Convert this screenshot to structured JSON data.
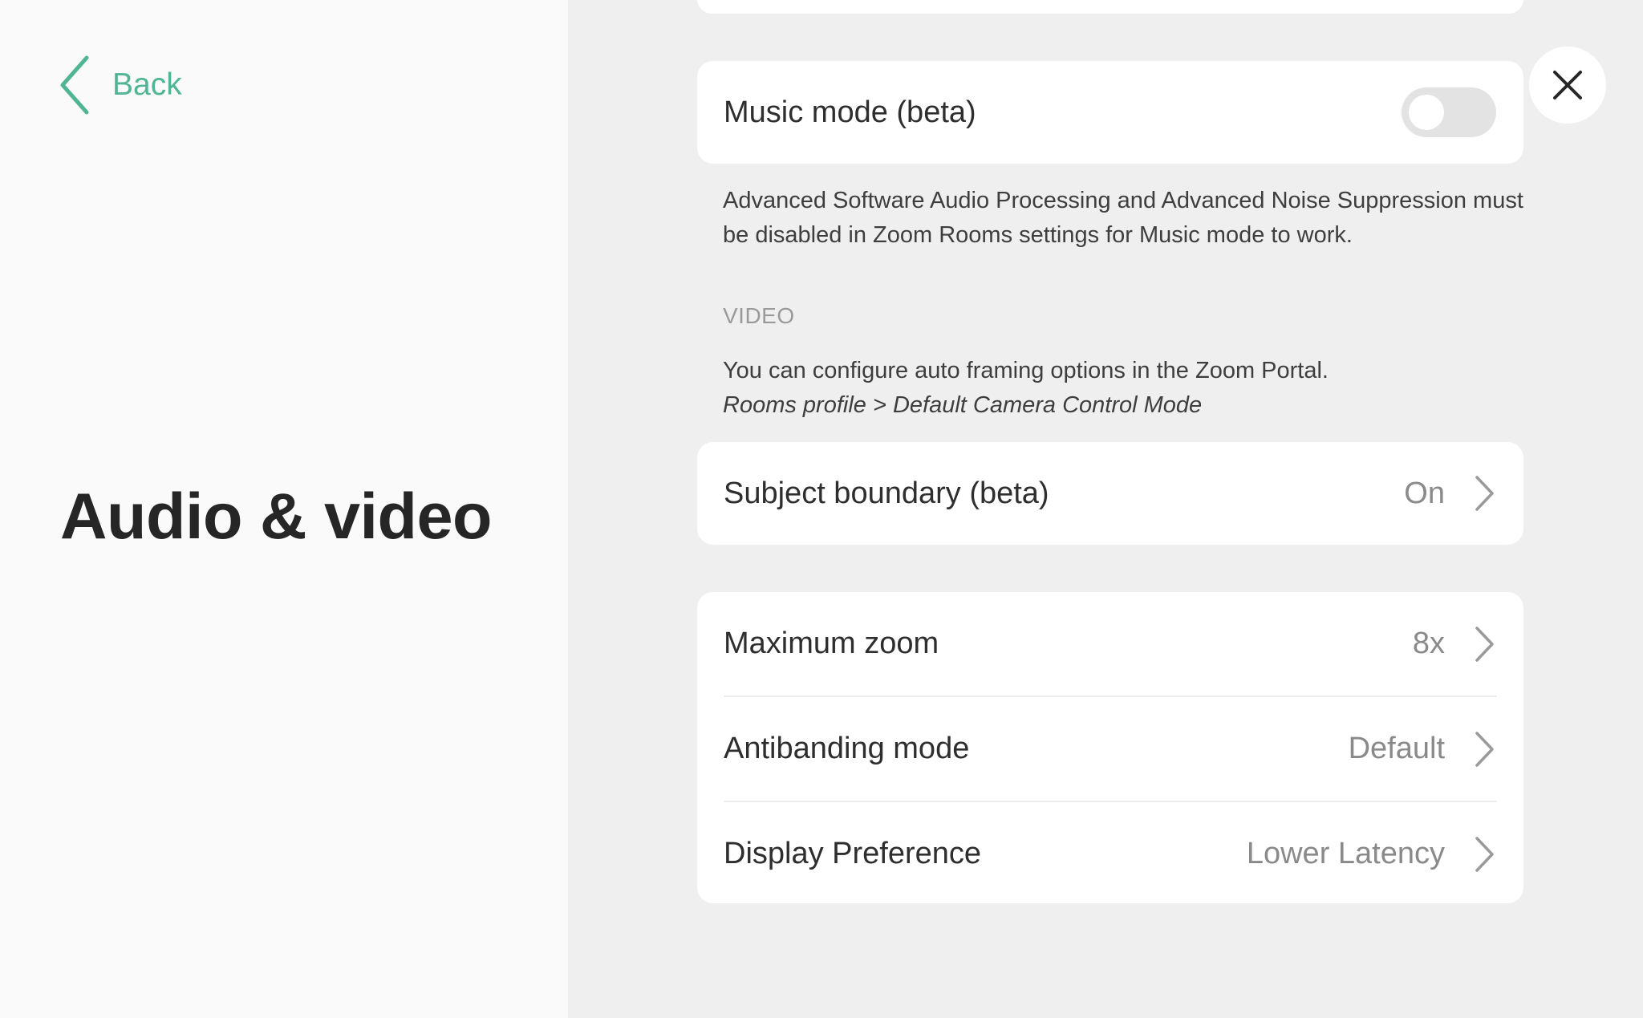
{
  "nav": {
    "back_label": "Back",
    "accent_color": "#4fb594"
  },
  "page": {
    "title": "Audio & video"
  },
  "audio": {
    "music_mode": {
      "label": "Music mode (beta)",
      "enabled": false
    },
    "music_mode_help": "Advanced Software Audio Processing and Advanced Noise Suppression must be disabled in Zoom Rooms settings for Music mode to work."
  },
  "video": {
    "section_label": "VIDEO",
    "help_text": "You can configure auto framing options in the Zoom Portal.",
    "help_path": "Rooms profile > Default Camera Control Mode",
    "subject_boundary": {
      "label": "Subject boundary (beta)",
      "value": "On"
    },
    "settings": [
      {
        "label": "Maximum zoom",
        "value": "8x"
      },
      {
        "label": "Antibanding mode",
        "value": "Default"
      },
      {
        "label": "Display Preference",
        "value": "Lower Latency"
      }
    ]
  },
  "icons": {
    "back": "chevron-left-icon",
    "close": "close-icon",
    "row_arrow": "chevron-right-icon"
  }
}
